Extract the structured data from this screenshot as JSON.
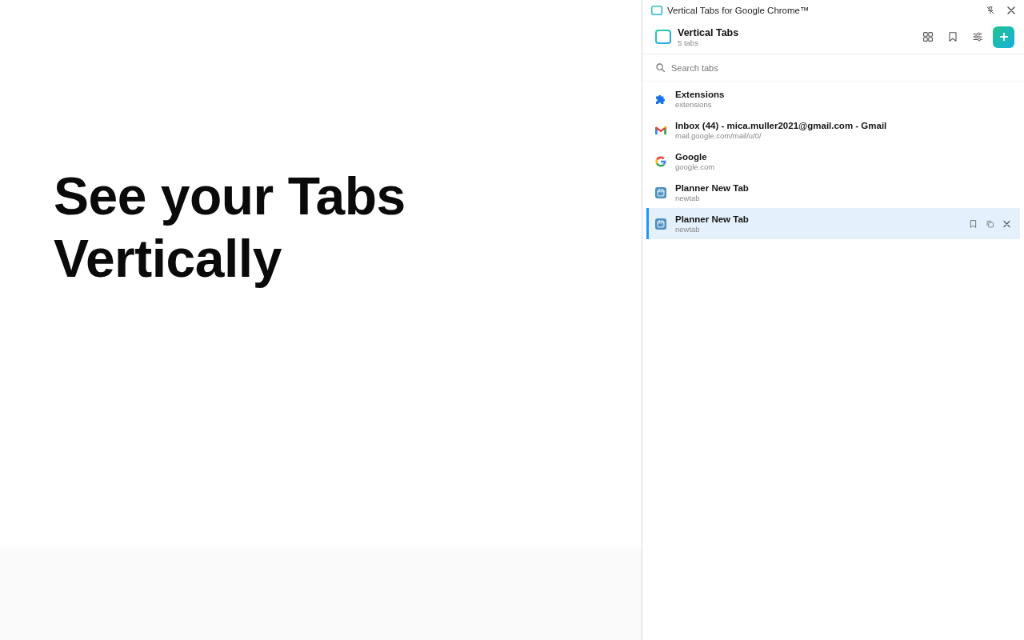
{
  "hero": {
    "heading": "See your Tabs Vertically"
  },
  "titlebar": {
    "title": "Vertical Tabs for Google Chrome™"
  },
  "header": {
    "title": "Vertical Tabs",
    "subtitle": "5 tabs"
  },
  "search": {
    "placeholder": "Search tabs"
  },
  "tabs": [
    {
      "kind": "extensions",
      "title": "Extensions",
      "url": "extensions",
      "selected": false
    },
    {
      "kind": "gmail",
      "title": "Inbox (44) - mica.muller2021@gmail.com - Gmail",
      "url": "mail.google.com/mail/u/0/",
      "selected": false
    },
    {
      "kind": "google",
      "title": "Google",
      "url": "google.com",
      "selected": false
    },
    {
      "kind": "planner",
      "title": "Planner New Tab",
      "url": "newtab",
      "selected": false
    },
    {
      "kind": "planner",
      "title": "Planner New Tab",
      "url": "newtab",
      "selected": true
    }
  ]
}
